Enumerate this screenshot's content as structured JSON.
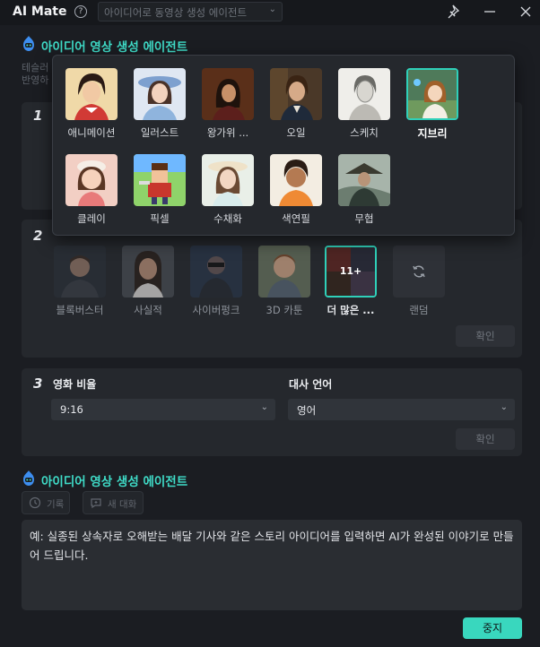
{
  "titlebar": {
    "app_title": "AI Mate",
    "mode_placeholder": "아이디어로 동영상 생성 에이전트",
    "help_glyph": "?"
  },
  "agent": {
    "title": "아이디어 영상 생성 에이전트",
    "subtitle_line1": "테슬러",
    "subtitle_line2": "반영하"
  },
  "steps": {
    "step1": "1",
    "step2": "2",
    "step3": "3"
  },
  "popup_styles": [
    {
      "label": "애니메이션",
      "icon": "anime-portrait"
    },
    {
      "label": "일러스트",
      "icon": "illustration-portrait"
    },
    {
      "label": "왕가위 ...",
      "icon": "wong-kar-wai-portrait"
    },
    {
      "label": "오일",
      "icon": "oil-painting-portrait"
    },
    {
      "label": "스케치",
      "icon": "sketch-portrait"
    },
    {
      "label": "지브리",
      "icon": "ghibli-portrait",
      "selected": true
    },
    {
      "label": "클레이",
      "icon": "clay-portrait"
    },
    {
      "label": "픽셀",
      "icon": "pixel-art-portrait"
    },
    {
      "label": "수채화",
      "icon": "watercolor-portrait"
    },
    {
      "label": "색연필",
      "icon": "colored-pencil-portrait"
    },
    {
      "label": "무협",
      "icon": "wuxia-portrait"
    }
  ],
  "step2_styles": [
    {
      "label": "블록버스터",
      "icon": "blockbuster-portrait"
    },
    {
      "label": "사실적",
      "icon": "realistic-portrait"
    },
    {
      "label": "사이버펑크",
      "icon": "cyberpunk-portrait"
    },
    {
      "label": "3D 카툰",
      "icon": "3d-cartoon-portrait"
    },
    {
      "label": "더 많은 ...",
      "icon": "more-styles-collage",
      "count": "11+"
    },
    {
      "label": "랜덤",
      "icon": "refresh-icon"
    }
  ],
  "step2_confirm": "확인",
  "step3": {
    "ratio_label": "영화 비율",
    "ratio_value": "9:16",
    "language_label": "대사 언어",
    "language_value": "영어",
    "confirm": "확인"
  },
  "agent2": {
    "title": "아이디어 영상 생성 에이전트",
    "history_button": "기록",
    "new_chat_button": "새 대화"
  },
  "prompt": {
    "text": "예: 실종된 상속자로 오해받는 배달 기사와 같은 스토리 아이디어를 입력하면 AI가 완성된 이야기로 만들어 드립니다."
  },
  "stop_button": "중지",
  "colors": {
    "accent": "#39d7be",
    "background": "#1b1d22",
    "card": "#25282d"
  }
}
